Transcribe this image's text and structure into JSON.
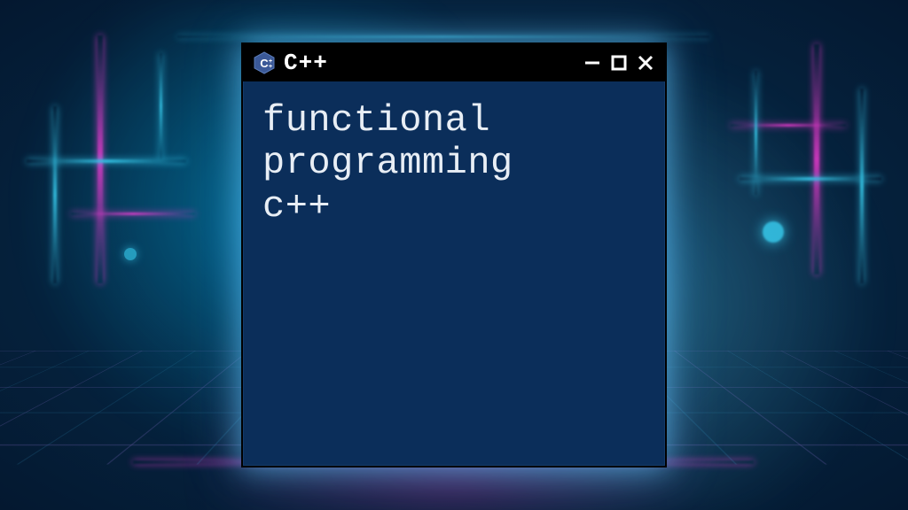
{
  "window": {
    "title": "C++",
    "icon": "cpp-hexagon-icon"
  },
  "content": {
    "line1": "functional",
    "line2": "programming",
    "line3": "c++"
  },
  "colors": {
    "window_bg": "#0b2e5a",
    "titlebar_bg": "#000000",
    "text": "#e8eef5",
    "accent_cyan": "#3cdcff",
    "accent_magenta": "#ff3cdc"
  }
}
